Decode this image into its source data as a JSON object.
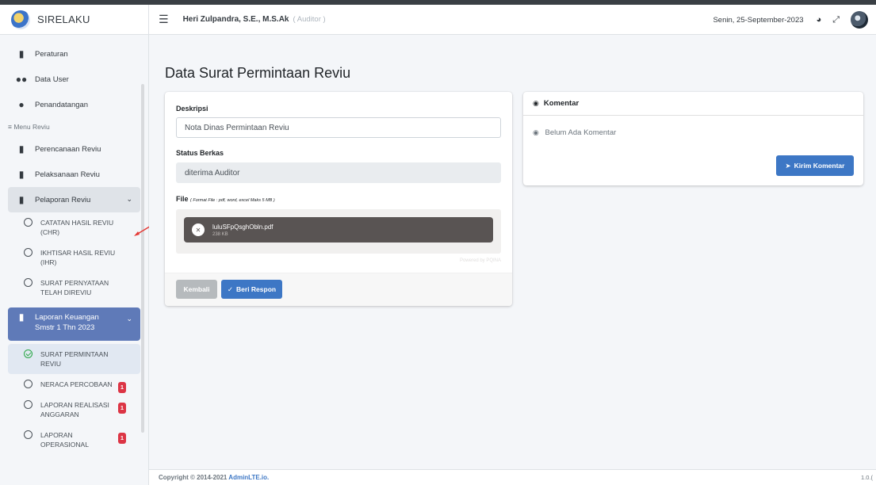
{
  "app": {
    "brand": "SIRELAKU"
  },
  "header": {
    "user_name": "Heri Zulpandra, S.E., M.S.Ak",
    "user_role": "( Auditor )",
    "date": "Senin, 25-September-2023"
  },
  "sidebar": {
    "items": [
      {
        "label": "Peraturan",
        "icon": "bookmark-icon"
      },
      {
        "label": "Data User",
        "icon": "users-icon"
      },
      {
        "label": "Penandatangan",
        "icon": "user-icon"
      }
    ],
    "section_header": "≡ Menu Reviu",
    "review_items": [
      {
        "label": "Perencanaan Reviu",
        "icon": "file-icon"
      },
      {
        "label": "Pelaksanaan Reviu",
        "icon": "file-icon"
      },
      {
        "label": "Pelaporan Reviu",
        "icon": "file-icon"
      }
    ],
    "pelaporan_sub": [
      "CATATAN HASIL REVIU (CHR)",
      "IKHTISAR HASIL REVIU (IHR)",
      "SURAT PERNYATAAN TELAH DIREVIU"
    ],
    "active_item": {
      "label": "Laporan Keuangan Smstr 1 Thn 2023",
      "icon": "file-invoice-icon"
    },
    "laporan_sub": [
      {
        "label": "SURAT PERMINTAAN REVIU",
        "badge": ""
      },
      {
        "label": "NERACA PERCOBAAN",
        "badge": "1"
      },
      {
        "label": "LAPORAN REALISASI ANGGARAN",
        "badge": "1"
      },
      {
        "label": "LAPORAN OPERASIONAL",
        "badge": "1"
      }
    ]
  },
  "main": {
    "title": "Data Surat Permintaan Reviu",
    "form": {
      "deskripsi_label": "Deskripsi",
      "deskripsi_value": "Nota Dinas Permintaan Reviu",
      "status_label": "Status Berkas",
      "status_value": "diterima Auditor",
      "file_label": "File",
      "file_hint": "( Format File : pdf, word, excel Maks 5 MB )",
      "file_name": "luluSFpQsghObln.pdf",
      "file_size": "238 KB",
      "powered_by": "Powered by PQINA",
      "back_button": "Kembali",
      "respond_button": "Beri Respon"
    },
    "comments": {
      "title": "Komentar",
      "empty_text": "Belum Ada Komentar",
      "send_button": "Kirim Komentar"
    }
  },
  "footer": {
    "copyright": "Copyright © 2014-2021 ",
    "link": "AdminLTE.io.",
    "version": "1.0.("
  },
  "colors": {
    "primary": "#3d77c5",
    "active_nav": "#5f7ab8",
    "badge": "#dc3545",
    "success": "#28a745"
  }
}
